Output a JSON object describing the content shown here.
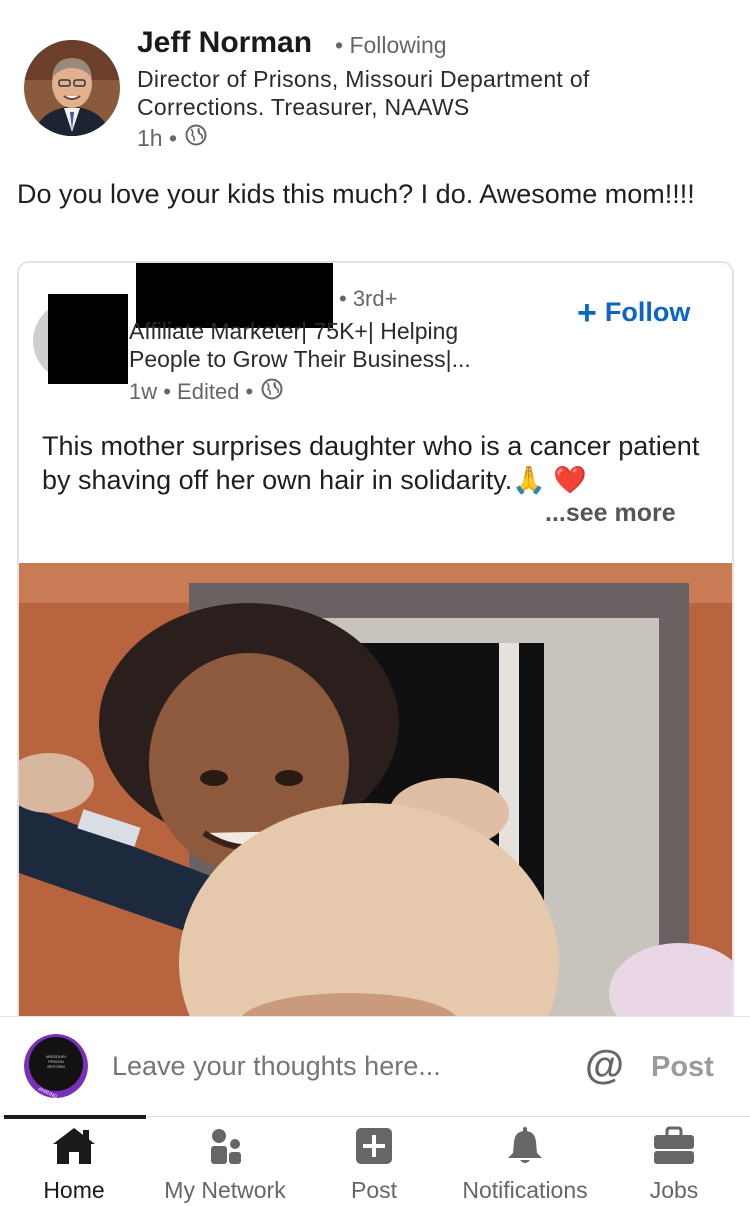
{
  "author": {
    "name": "Jeff Norman",
    "follow_status": "• Following",
    "headline": "Director of Prisons, Missouri Department of Corrections. Treasurer, NAAWS",
    "time": "1h •"
  },
  "post": {
    "text": "Do you love your kids this much? I do. Awesome mom!!!!"
  },
  "shared_post": {
    "degree": "• 3rd+",
    "headline": "Affiliate Marketer| 75K+| Helping People to Grow Their Business|...",
    "meta": "1w • Edited •",
    "follow_label": "Follow",
    "text": "This mother surprises daughter who is a cancer patient by shaving off her own hair in solidarity.🙏 ❤️",
    "see_more": "...see more"
  },
  "comment_bar": {
    "placeholder": "Leave your thoughts here...",
    "at_symbol": "@",
    "post_label": "Post",
    "avatar_text": "MISSOURI PRISON REFORM",
    "avatar_badge": "#HIRING"
  },
  "nav": {
    "tabs": [
      {
        "label": "Home",
        "icon": "home-icon",
        "active": true
      },
      {
        "label": "My Network",
        "icon": "network-icon",
        "active": false
      },
      {
        "label": "Post",
        "icon": "post-icon",
        "active": false
      },
      {
        "label": "Notifications",
        "icon": "bell-icon",
        "active": false
      },
      {
        "label": "Jobs",
        "icon": "briefcase-icon",
        "active": false
      }
    ]
  },
  "colors": {
    "accent": "#0a66c2",
    "text": "#1f1f1f",
    "muted": "#666666"
  }
}
